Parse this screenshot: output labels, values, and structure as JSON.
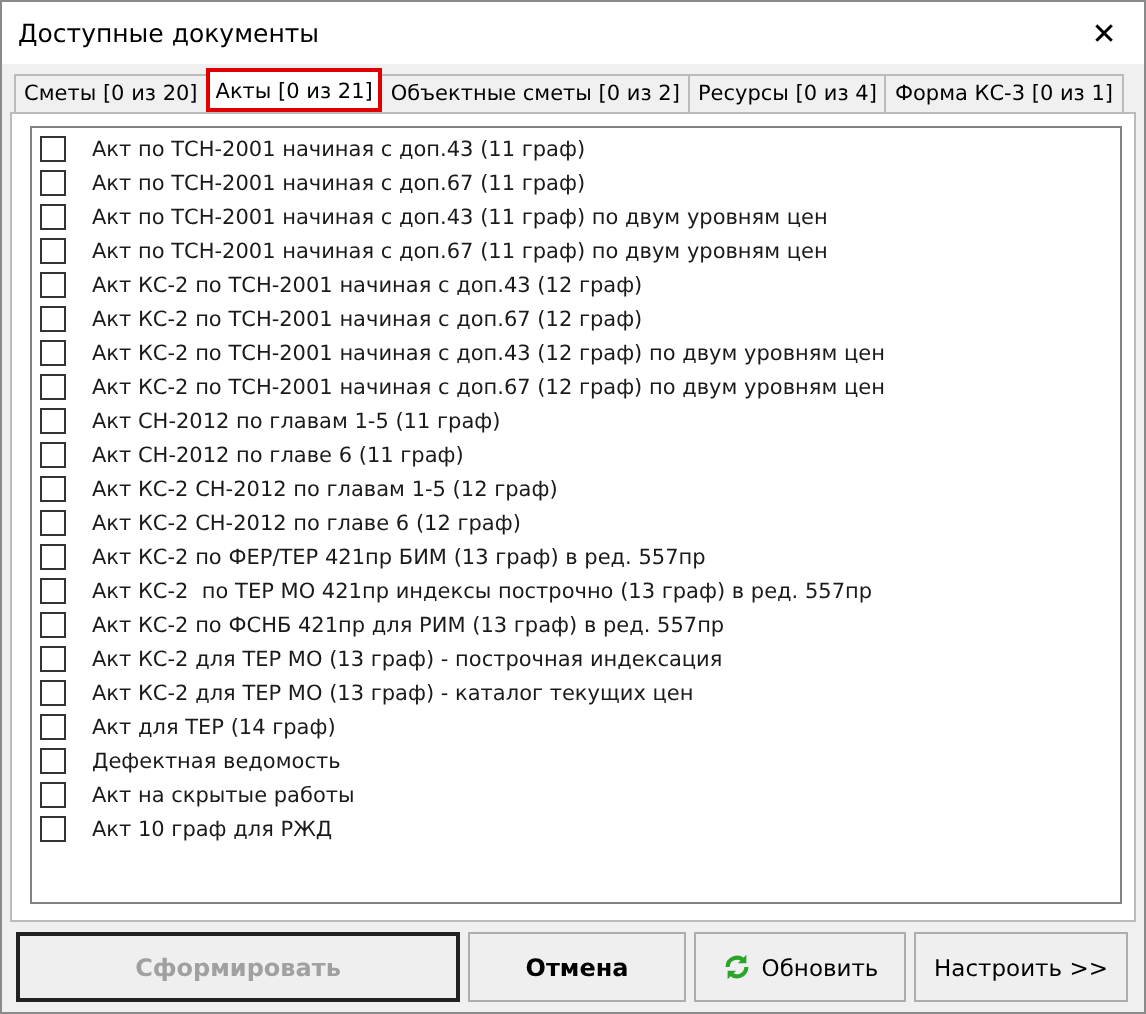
{
  "window": {
    "title": "Доступные документы",
    "close": "✕"
  },
  "tabs": [
    {
      "label": "Сметы [0 из 20]",
      "selected": false
    },
    {
      "label": "Акты [0 из 21]",
      "selected": true
    },
    {
      "label": "Объектные сметы [0 из 2]",
      "selected": false
    },
    {
      "label": "Ресурсы [0 из 4]",
      "selected": false
    },
    {
      "label": "Форма КС-3 [0 из 1]",
      "selected": false
    }
  ],
  "items": [
    {
      "label": "Акт по ТСН-2001 начиная с доп.43 (11 граф)",
      "checked": false
    },
    {
      "label": "Акт по ТСН-2001 начиная с доп.67 (11 граф)",
      "checked": false
    },
    {
      "label": "Акт по ТСН-2001 начиная с доп.43 (11 граф) по двум уровням цен",
      "checked": false
    },
    {
      "label": "Акт по ТСН-2001 начиная с доп.67 (11 граф) по двум уровням цен",
      "checked": false
    },
    {
      "label": "Акт КС-2 по ТСН-2001 начиная с доп.43 (12 граф)",
      "checked": false
    },
    {
      "label": "Акт КС-2 по ТСН-2001 начиная с доп.67 (12 граф)",
      "checked": false
    },
    {
      "label": "Акт КС-2 по ТСН-2001 начиная с доп.43 (12 граф) по двум уровням цен",
      "checked": false
    },
    {
      "label": "Акт КС-2 по ТСН-2001 начиная с доп.67 (12 граф) по двум уровням цен",
      "checked": false
    },
    {
      "label": "Акт СН-2012 по главам 1-5 (11 граф)",
      "checked": false
    },
    {
      "label": "Акт СН-2012 по главе 6 (11 граф)",
      "checked": false
    },
    {
      "label": "Акт КС-2 СН-2012 по главам 1-5 (12 граф)",
      "checked": false
    },
    {
      "label": "Акт КС-2 СН-2012 по главе 6 (12 граф)",
      "checked": false
    },
    {
      "label": "Акт КС-2 по ФЕР/ТЕР 421пр БИМ (13 граф) в ред. 557пр",
      "checked": false
    },
    {
      "label": "Акт КС-2  по ТЕР МО 421пр индексы построчно (13 граф) в ред. 557пр",
      "checked": false
    },
    {
      "label": "Акт КС-2 по ФСНБ 421пр для РИМ (13 граф) в ред. 557пр",
      "checked": false
    },
    {
      "label": "Акт КС-2 для ТЕР МО (13 граф) - построчная индексация",
      "checked": false
    },
    {
      "label": "Акт КС-2 для ТЕР МО (13 граф) - каталог текущих цен",
      "checked": false
    },
    {
      "label": "Акт для ТЕР (14 граф)",
      "checked": false
    },
    {
      "label": "Дефектная ведомость",
      "checked": false
    },
    {
      "label": "Акт на скрытые работы",
      "checked": false
    },
    {
      "label": "Акт 10 граф для РЖД",
      "checked": false
    }
  ],
  "buttons": [
    {
      "label": "Сформировать",
      "kind": "default",
      "disabled": true
    },
    {
      "label": "Отмена",
      "kind": "bold",
      "disabled": false
    },
    {
      "label": "Обновить",
      "kind": "refresh",
      "disabled": false
    },
    {
      "label": "Настроить >>",
      "kind": "plain",
      "disabled": false
    }
  ]
}
